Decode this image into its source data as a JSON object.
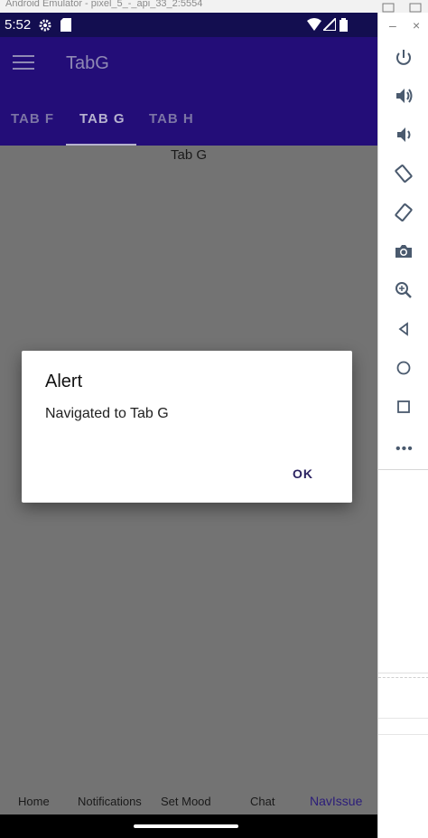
{
  "emulator": {
    "title": "Android Emulator - pixel_5_-_api_33_2:5554"
  },
  "status_bar": {
    "time": "5:52"
  },
  "app_bar": {
    "title": "TabG",
    "tabs": [
      {
        "label": "TAB F"
      },
      {
        "label": "TAB G"
      },
      {
        "label": "TAB H"
      }
    ],
    "active_tab_index": 1
  },
  "page": {
    "content_label": "Tab G"
  },
  "dialog": {
    "title": "Alert",
    "message": "Navigated to Tab G",
    "ok_label": "OK"
  },
  "bottom_nav": {
    "items": [
      {
        "label": "Home"
      },
      {
        "label": "Notifications"
      },
      {
        "label": "Set Mood"
      },
      {
        "label": "Chat"
      },
      {
        "label": "NavIssue"
      }
    ],
    "active_index": 4
  },
  "side_panel": {
    "buttons": [
      "power-icon",
      "volume-up-icon",
      "volume-down-icon",
      "rotate-left-icon",
      "rotate-right-icon",
      "camera-icon",
      "zoom-icon",
      "back-icon",
      "home-icon",
      "overview-icon",
      "more-icon"
    ],
    "minimize_glyph": "–",
    "close_glyph": "×"
  },
  "colors": {
    "status_bar": "#130e50",
    "app_bar": "#230d78",
    "scrim": "#737373",
    "accent": "#2b1d7a"
  }
}
